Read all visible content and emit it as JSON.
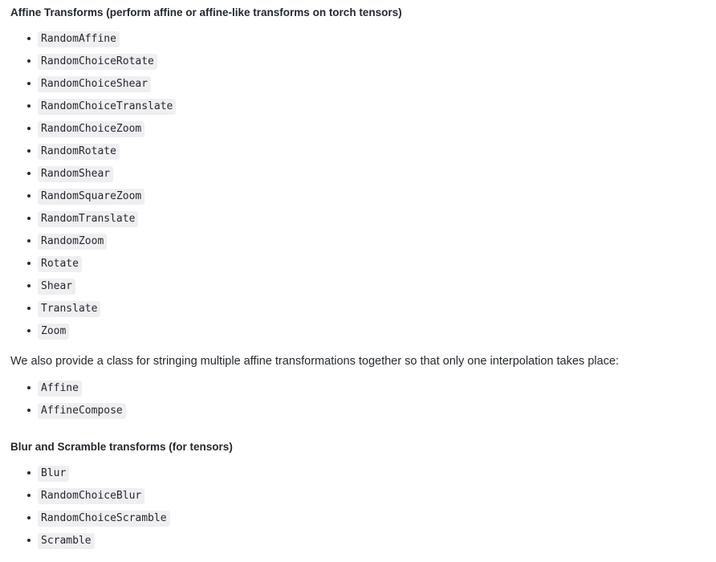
{
  "document": {
    "sections": [
      {
        "heading": "Affine Transforms (perform affine or affine-like transforms on torch tensors)",
        "items": [
          "RandomAffine",
          "RandomChoiceRotate",
          "RandomChoiceShear",
          "RandomChoiceTranslate",
          "RandomChoiceZoom",
          "RandomRotate",
          "RandomShear",
          "RandomSquareZoom",
          "RandomTranslate",
          "RandomZoom",
          "Rotate",
          "Shear",
          "Translate",
          "Zoom"
        ]
      }
    ],
    "paragraph": "We also provide a class for stringing multiple affine transformations together so that only one interpolation takes place:",
    "affine_compose_items": [
      "Affine",
      "AffineCompose"
    ],
    "blur_section": {
      "heading": "Blur and Scramble transforms (for tensors)",
      "items": [
        "Blur",
        "RandomChoiceBlur",
        "RandomChoiceScramble",
        "Scramble"
      ]
    }
  },
  "colors": {
    "text": "#24292e",
    "code_background": "#efeff1",
    "page_background": "#ffffff"
  }
}
